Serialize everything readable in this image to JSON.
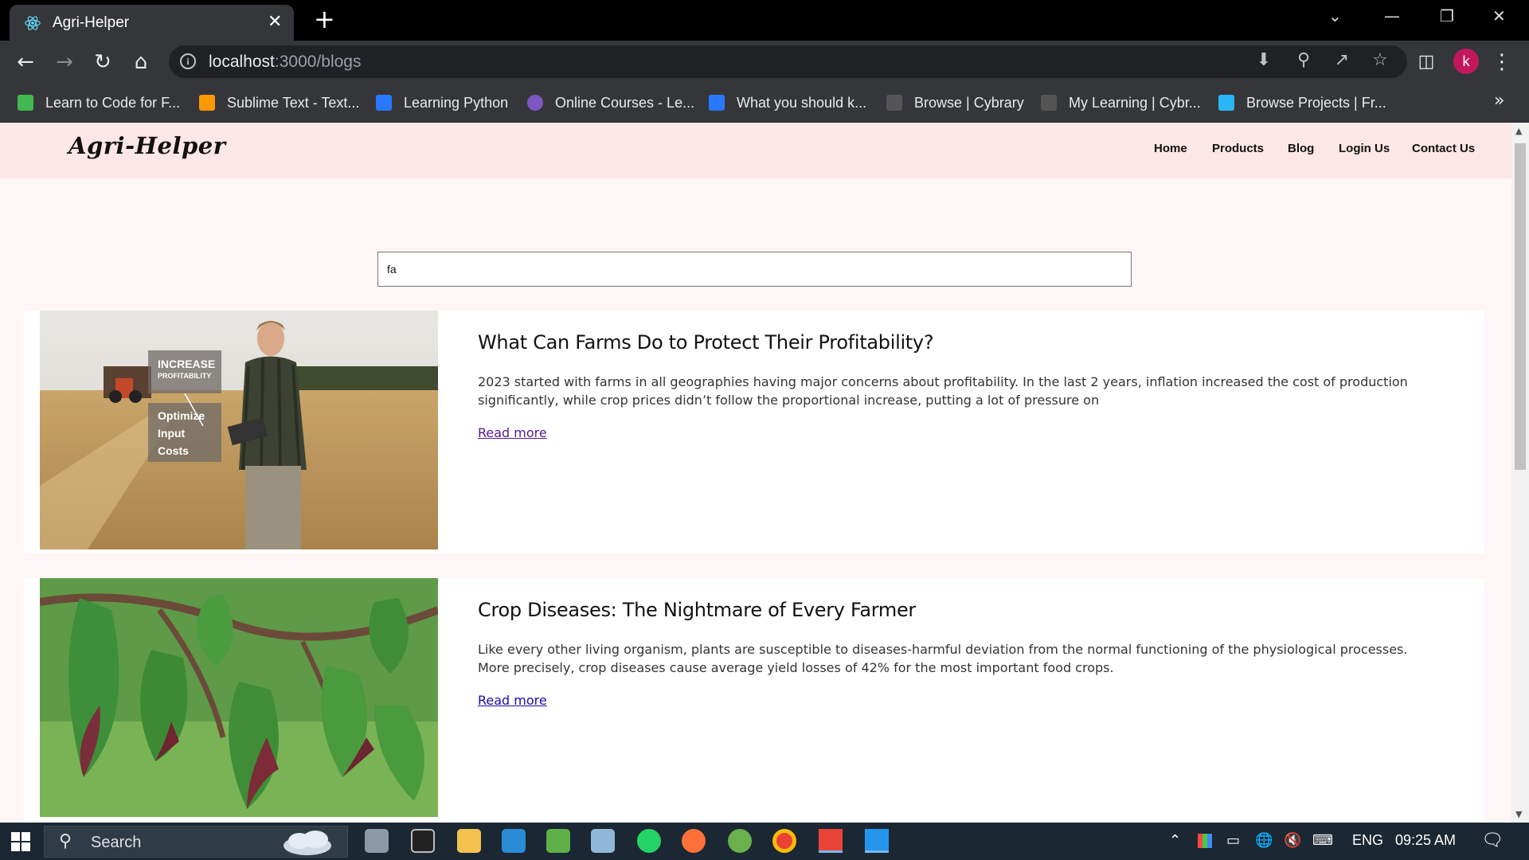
{
  "browser": {
    "tab_title": "Agri-Helper",
    "tab_close": "✕",
    "new_tab": "+",
    "url_host": "localhost",
    "url_rest": ":3000/blogs",
    "avatar_letter": "k",
    "bookmarks": [
      {
        "label": "Learn to Code for F...",
        "color": "#3fb950"
      },
      {
        "label": "Sublime Text - Text...",
        "color": "#ff9800"
      },
      {
        "label": "Learning Python",
        "color": "#2979ff"
      },
      {
        "label": "Online Courses - Le...",
        "color": "#7e57c2"
      },
      {
        "label": "What you should k...",
        "color": "#2979ff"
      },
      {
        "label": "Browse | Cybrary",
        "color": "#333333"
      },
      {
        "label": "My Learning | Cybr...",
        "color": "#333333"
      },
      {
        "label": "Browse Projects | Fr...",
        "color": "#29b6f6"
      }
    ],
    "bookmarks_more": "»"
  },
  "site": {
    "logo": "Agri-Helper",
    "nav": [
      "Home",
      "Products",
      "Blog",
      "Login Us",
      "Contact Us"
    ],
    "search_value": "fa"
  },
  "posts": [
    {
      "title": "What Can Farms Do to Protect Their Profitability?",
      "excerpt": "2023 started with farms in all geographies having major concerns about profitability. In the last 2 years, inflation increased the cost of production significantly, while crop prices didn’t follow the proportional increase, putting a lot of pressure on",
      "link": "Read more",
      "image_overlay": {
        "line1": "INCREASE",
        "line2": "PROFITABILITY",
        "line3": "Optimize",
        "line4": "Input",
        "line5": "Costs"
      }
    },
    {
      "title": "Crop Diseases: The Nightmare of Every Farmer",
      "excerpt": "Like every other living organism, plants are susceptible to diseases-harmful deviation from the normal functioning of the physiological processes. More precisely, crop diseases cause average yield losses of 42% for the most important food crops.",
      "link": "Read more"
    }
  ],
  "taskbar": {
    "search_label": "Search",
    "language": "ENG",
    "time": "09:25 AM"
  },
  "colors": {
    "nav_bg": "#fde6e6",
    "page_bg": "#fff6f5",
    "link_visited": "#551a8b",
    "link": "#1a0dab"
  }
}
